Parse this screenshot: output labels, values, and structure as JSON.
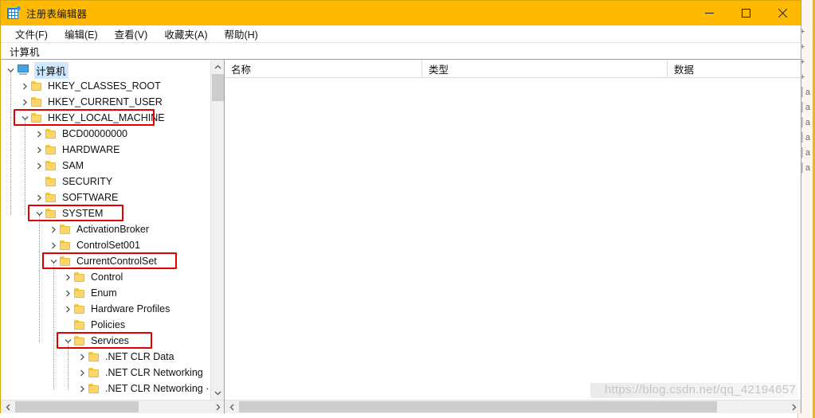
{
  "window": {
    "title": "注册表编辑器",
    "icon": "registry-editor-icon",
    "accent_color": "#ffb900",
    "border_color": "#d9a400",
    "controls": {
      "minimize": "—",
      "maximize": "□",
      "close": "✕"
    }
  },
  "menubar": {
    "items": [
      {
        "label": "文件(F)"
      },
      {
        "label": "编辑(E)"
      },
      {
        "label": "查看(V)"
      },
      {
        "label": "收藏夹(A)"
      },
      {
        "label": "帮助(H)"
      }
    ]
  },
  "addressbar": {
    "value": "计算机",
    "placeholder": "计算机"
  },
  "tree": {
    "nodes": [
      {
        "label": "计算机",
        "depth": 0,
        "icon": "computer-icon",
        "twisty": "expanded",
        "selected": true,
        "annotated": false
      },
      {
        "label": "HKEY_CLASSES_ROOT",
        "depth": 1,
        "icon": "folder-icon",
        "twisty": "collapsed",
        "selected": false,
        "annotated": false
      },
      {
        "label": "HKEY_CURRENT_USER",
        "depth": 1,
        "icon": "folder-icon",
        "twisty": "collapsed",
        "selected": false,
        "annotated": false
      },
      {
        "label": "HKEY_LOCAL_MACHINE",
        "depth": 1,
        "icon": "folder-icon",
        "twisty": "expanded",
        "selected": false,
        "annotated": true
      },
      {
        "label": "BCD00000000",
        "depth": 2,
        "icon": "folder-icon",
        "twisty": "collapsed",
        "selected": false,
        "annotated": false
      },
      {
        "label": "HARDWARE",
        "depth": 2,
        "icon": "folder-icon",
        "twisty": "collapsed",
        "selected": false,
        "annotated": false
      },
      {
        "label": "SAM",
        "depth": 2,
        "icon": "folder-icon",
        "twisty": "collapsed",
        "selected": false,
        "annotated": false
      },
      {
        "label": "SECURITY",
        "depth": 2,
        "icon": "folder-icon",
        "twisty": "none",
        "selected": false,
        "annotated": false
      },
      {
        "label": "SOFTWARE",
        "depth": 2,
        "icon": "folder-icon",
        "twisty": "collapsed",
        "selected": false,
        "annotated": false
      },
      {
        "label": "SYSTEM",
        "depth": 2,
        "icon": "folder-icon",
        "twisty": "expanded",
        "selected": false,
        "annotated": true
      },
      {
        "label": "ActivationBroker",
        "depth": 3,
        "icon": "folder-icon",
        "twisty": "collapsed",
        "selected": false,
        "annotated": false
      },
      {
        "label": "ControlSet001",
        "depth": 3,
        "icon": "folder-icon",
        "twisty": "collapsed",
        "selected": false,
        "annotated": false
      },
      {
        "label": "CurrentControlSet",
        "depth": 3,
        "icon": "folder-icon",
        "twisty": "expanded",
        "selected": false,
        "annotated": true
      },
      {
        "label": "Control",
        "depth": 4,
        "icon": "folder-icon",
        "twisty": "collapsed",
        "selected": false,
        "annotated": false
      },
      {
        "label": "Enum",
        "depth": 4,
        "icon": "folder-icon",
        "twisty": "collapsed",
        "selected": false,
        "annotated": false
      },
      {
        "label": "Hardware Profiles",
        "depth": 4,
        "icon": "folder-icon",
        "twisty": "collapsed",
        "selected": false,
        "annotated": false
      },
      {
        "label": "Policies",
        "depth": 4,
        "icon": "folder-icon",
        "twisty": "none",
        "selected": false,
        "annotated": false
      },
      {
        "label": "Services",
        "depth": 4,
        "icon": "folder-icon",
        "twisty": "expanded",
        "selected": false,
        "annotated": true
      },
      {
        "label": ".NET CLR Data",
        "depth": 5,
        "icon": "folder-icon",
        "twisty": "collapsed",
        "selected": false,
        "annotated": false
      },
      {
        "label": ".NET CLR Networking",
        "depth": 5,
        "icon": "folder-icon",
        "twisty": "collapsed",
        "selected": false,
        "annotated": false
      },
      {
        "label": ".NET CLR Networking ·",
        "depth": 5,
        "icon": "folder-icon",
        "twisty": "collapsed",
        "selected": false,
        "annotated": false
      }
    ],
    "annotation_color": "#e00000"
  },
  "list": {
    "columns": [
      {
        "label": "名称"
      },
      {
        "label": "类型"
      },
      {
        "label": "数据"
      }
    ],
    "rows": []
  },
  "watermark": {
    "text": "https://blog.csdn.net/qq_42194657"
  },
  "background_window": {
    "fragments": [
      "+",
      "+",
      "+",
      "+",
      "│a",
      "│a",
      "│a",
      "│a",
      "│a",
      "│a"
    ]
  }
}
